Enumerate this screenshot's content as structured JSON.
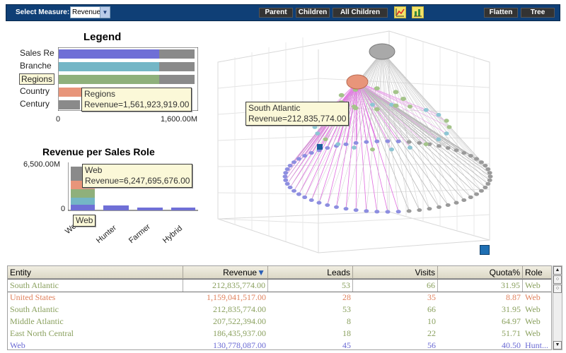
{
  "toolbar": {
    "measure_label": "Select Measure:",
    "measure_value": "Revenue",
    "buttons": {
      "parent": "Parent",
      "children": "Children",
      "all_children": "All Children",
      "flatten": "Flatten",
      "tree": "Tree"
    }
  },
  "legend": {
    "title": "Legend",
    "labels": [
      "Sales Re",
      "Branche",
      "Regions",
      "Country",
      "Century"
    ],
    "axis_min": "0",
    "axis_max": "1,600.00M",
    "tooltip_line1": "Regions",
    "tooltip_line2": "Revenue=1,561,923,919.00",
    "label_tooltip": "Regions",
    "colors": [
      "#6f6fd6",
      "#74b6c6",
      "#8fb07c",
      "#e8957a",
      "#8a8a8a"
    ]
  },
  "revenue_chart": {
    "title": "Revenue per Sales Role",
    "ymax_label": "6,500.00M",
    "ymin_label": "0",
    "categories": [
      "Web",
      "Hunter",
      "Farmer",
      "Hybrid"
    ],
    "tooltip_line1": "Web",
    "tooltip_line2": "Revenue=6,247,695,676.00",
    "category_tooltip": "Web"
  },
  "view3d": {
    "tooltip_line1": "South Atlantic",
    "tooltip_line2": "Revenue=212,835,774.00"
  },
  "table": {
    "columns": [
      "Entity",
      "Revenue",
      "Leads",
      "Visits",
      "Quota%",
      "Role"
    ],
    "sort_indicator": "▼",
    "rows": [
      {
        "entity": "South Atlantic",
        "revenue": "212,835,774.00",
        "leads": "53",
        "visits": "66",
        "quota": "31.95",
        "role": "Web",
        "color": "#8aa05e"
      },
      {
        "entity": "United States",
        "revenue": "1,159,041,517.00",
        "leads": "28",
        "visits": "35",
        "quota": "8.87",
        "role": "Web",
        "color": "#e0825e"
      },
      {
        "entity": "South Atlantic",
        "revenue": "212,835,774.00",
        "leads": "53",
        "visits": "66",
        "quota": "31.95",
        "role": "Web",
        "color": "#8aa05e"
      },
      {
        "entity": "Middle Atlantic",
        "revenue": "207,522,394.00",
        "leads": "8",
        "visits": "10",
        "quota": "64.97",
        "role": "Web",
        "color": "#8aa05e"
      },
      {
        "entity": "East North Central",
        "revenue": "186,435,937.00",
        "leads": "18",
        "visits": "22",
        "quota": "51.71",
        "role": "Web",
        "color": "#8aa05e"
      },
      {
        "entity": "Web",
        "revenue": "130,778,087.00",
        "leads": "45",
        "visits": "56",
        "quota": "40.50",
        "role": "Hunt...",
        "color": "#6a6ad4"
      }
    ]
  }
}
